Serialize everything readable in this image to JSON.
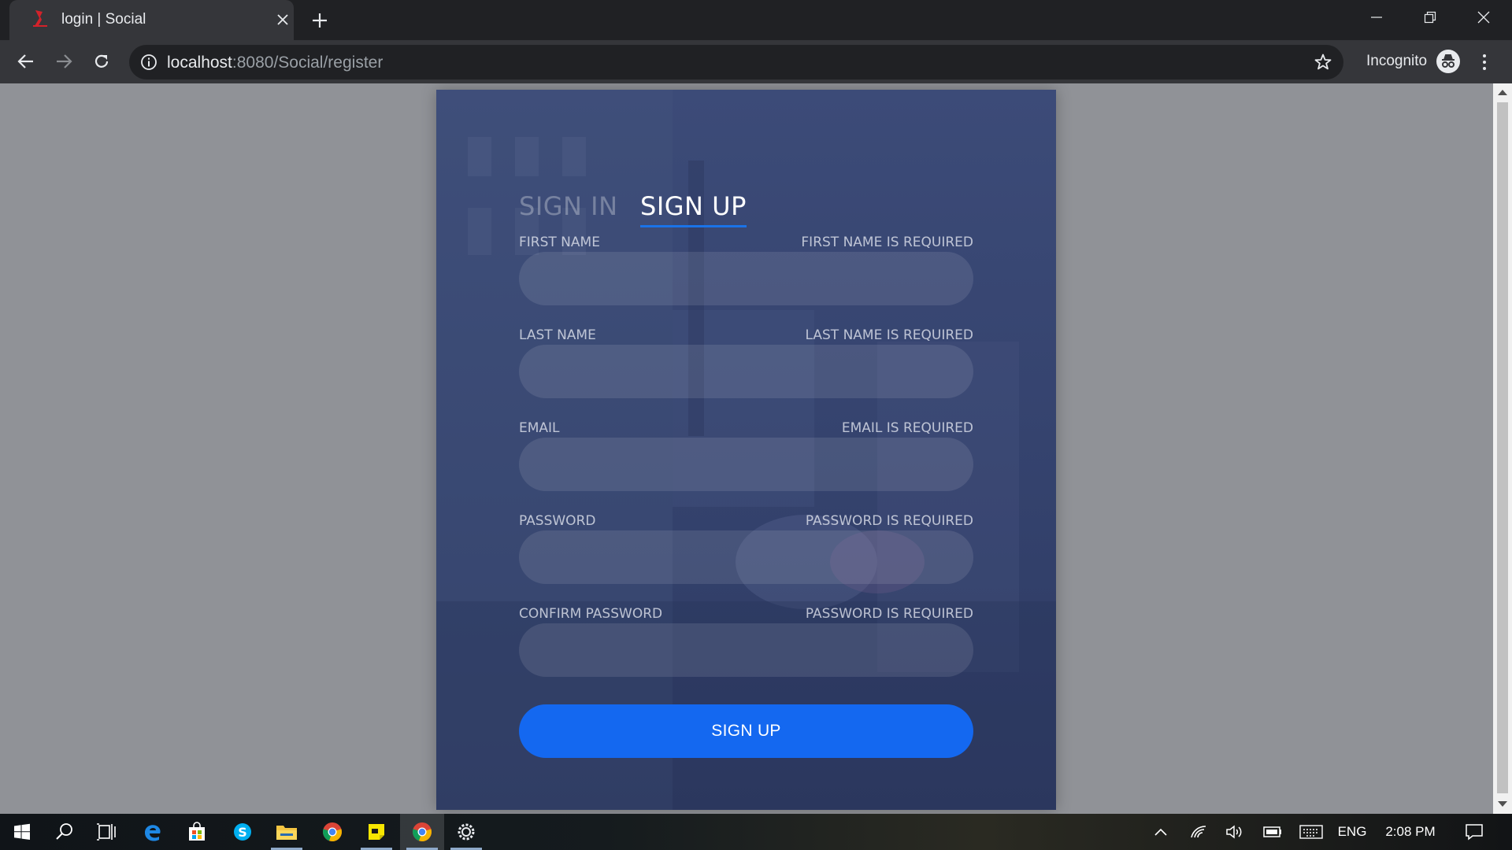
{
  "browser": {
    "tab_title": "login | Social",
    "url_host": "localhost",
    "url_path": ":8080/Social/register",
    "profile_label": "Incognito"
  },
  "auth": {
    "tabs": [
      {
        "label": "SIGN IN",
        "active": false
      },
      {
        "label": "SIGN UP",
        "active": true
      }
    ],
    "fields": [
      {
        "label": "FIRST NAME",
        "error": "FIRST NAME IS REQUIRED",
        "value": ""
      },
      {
        "label": "LAST NAME",
        "error": "LAST NAME IS REQUIRED",
        "value": ""
      },
      {
        "label": "EMAIL",
        "error": "EMAIL IS REQUIRED",
        "value": ""
      },
      {
        "label": "PASSWORD",
        "error": "PASSWORD IS REQUIRED",
        "value": ""
      },
      {
        "label": "CONFIRM PASSWORD",
        "error": "PASSWORD IS REQUIRED",
        "value": ""
      }
    ],
    "submit_label": "SIGN UP"
  },
  "taskbar": {
    "apps": [
      "start-icon",
      "search-icon",
      "task-view-icon",
      "edge-icon",
      "store-icon",
      "skype-icon",
      "file-explorer-icon",
      "chrome-icon",
      "sticky-notes-icon",
      "chrome-incognito-icon",
      "settings-app-icon"
    ],
    "language": "ENG",
    "time": "2:08 PM"
  },
  "colors": {
    "accent": "#1468f0",
    "card": "#3c4b78",
    "page_background": "#909297"
  }
}
